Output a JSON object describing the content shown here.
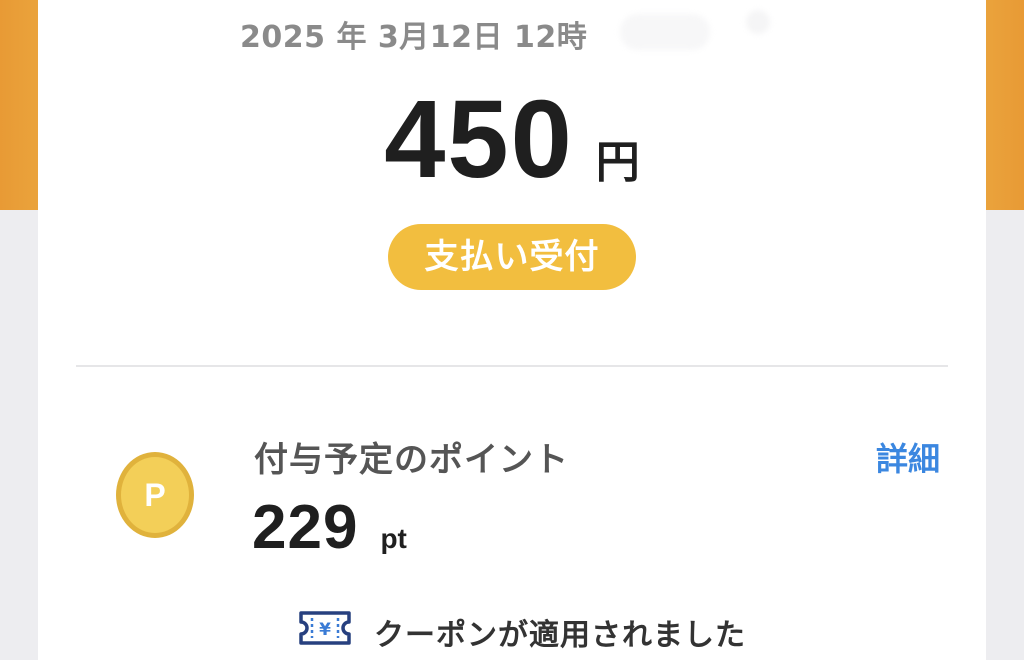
{
  "colors": {
    "header_band": "#e89a35",
    "badge": "#f2be3f",
    "link": "#3b87e0",
    "coin_fill": "#f3cf58",
    "coin_edge": "#e0b23c",
    "coupon_icon": "#27407f"
  },
  "transaction": {
    "datetime": "2025 年 3月12日 12時",
    "amount": "450",
    "currency": "円",
    "status": "支払い受付"
  },
  "points": {
    "label": "付与予定のポイント",
    "details_link": "詳細",
    "value": "229",
    "unit": "pt",
    "coin_letter": "P",
    "icon": "point-coin-icon"
  },
  "coupon": {
    "icon": "ticket-yen-icon",
    "icon_symbol": "¥",
    "message": "クーポンが適用されました"
  }
}
